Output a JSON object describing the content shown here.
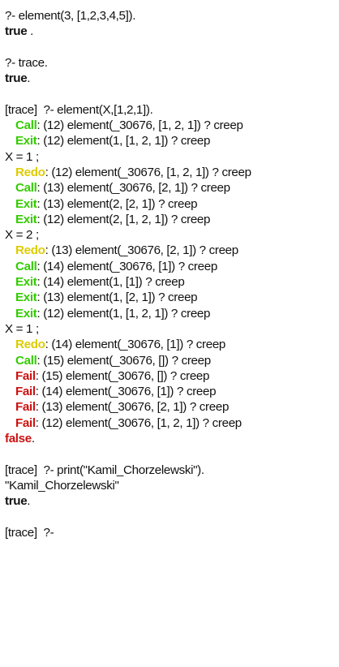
{
  "query1": "?- element(3, [1,2,3,4,5]).",
  "result1": "true",
  "result1_suffix": " .",
  "query2": "?- trace.",
  "result2": "true",
  "result2_suffix": ".",
  "query3": "[trace]  ?- element(X,[1,2,1]).",
  "trace_lines": [
    {
      "port": "Call",
      "cls": "call",
      "text": " (12) element(_30676, [1, 2, 1]) ? creep"
    },
    {
      "port": "Exit",
      "cls": "exit",
      "text": " (12) element(1, [1, 2, 1]) ? creep"
    }
  ],
  "answer1": "X = 1 ;",
  "trace_lines2": [
    {
      "port": "Redo",
      "cls": "redo",
      "text": " (12) element(_30676, [1, 2, 1]) ? creep"
    },
    {
      "port": "Call",
      "cls": "call",
      "text": " (13) element(_30676, [2, 1]) ? creep"
    },
    {
      "port": "Exit",
      "cls": "exit",
      "text": " (13) element(2, [2, 1]) ? creep"
    },
    {
      "port": "Exit",
      "cls": "exit",
      "text": " (12) element(2, [1, 2, 1]) ? creep"
    }
  ],
  "answer2": "X = 2 ;",
  "trace_lines3": [
    {
      "port": "Redo",
      "cls": "redo",
      "text": " (13) element(_30676, [2, 1]) ? creep"
    },
    {
      "port": "Call",
      "cls": "call",
      "text": " (14) element(_30676, [1]) ? creep"
    },
    {
      "port": "Exit",
      "cls": "exit",
      "text": " (14) element(1, [1]) ? creep"
    },
    {
      "port": "Exit",
      "cls": "exit",
      "text": " (13) element(1, [2, 1]) ? creep"
    },
    {
      "port": "Exit",
      "cls": "exit",
      "text": " (12) element(1, [1, 2, 1]) ? creep"
    }
  ],
  "answer3": "X = 1 ;",
  "trace_lines4": [
    {
      "port": "Redo",
      "cls": "redo",
      "text": " (14) element(_30676, [1]) ? creep"
    },
    {
      "port": "Call",
      "cls": "call",
      "text": " (15) element(_30676, []) ? creep"
    },
    {
      "port": "Fail",
      "cls": "fail",
      "text": " (15) element(_30676, []) ? creep"
    },
    {
      "port": "Fail",
      "cls": "fail",
      "text": " (14) element(_30676, [1]) ? creep"
    },
    {
      "port": "Fail",
      "cls": "fail",
      "text": " (13) element(_30676, [2, 1]) ? creep"
    },
    {
      "port": "Fail",
      "cls": "fail",
      "text": " (12) element(_30676, [1, 2, 1]) ? creep"
    }
  ],
  "result3": "false",
  "result3_suffix": ".",
  "query4": "[trace]  ?- print(\"Kamil_Chorzelewski\").",
  "print_output": "\"Kamil_Chorzelewski\"",
  "result4": "true",
  "result4_suffix": ".",
  "prompt": "[trace]  ?-",
  "colors": {
    "call_exit": "#33cc00",
    "redo": "#ddcc00",
    "fail": "#cc1111",
    "text": "#111111"
  }
}
